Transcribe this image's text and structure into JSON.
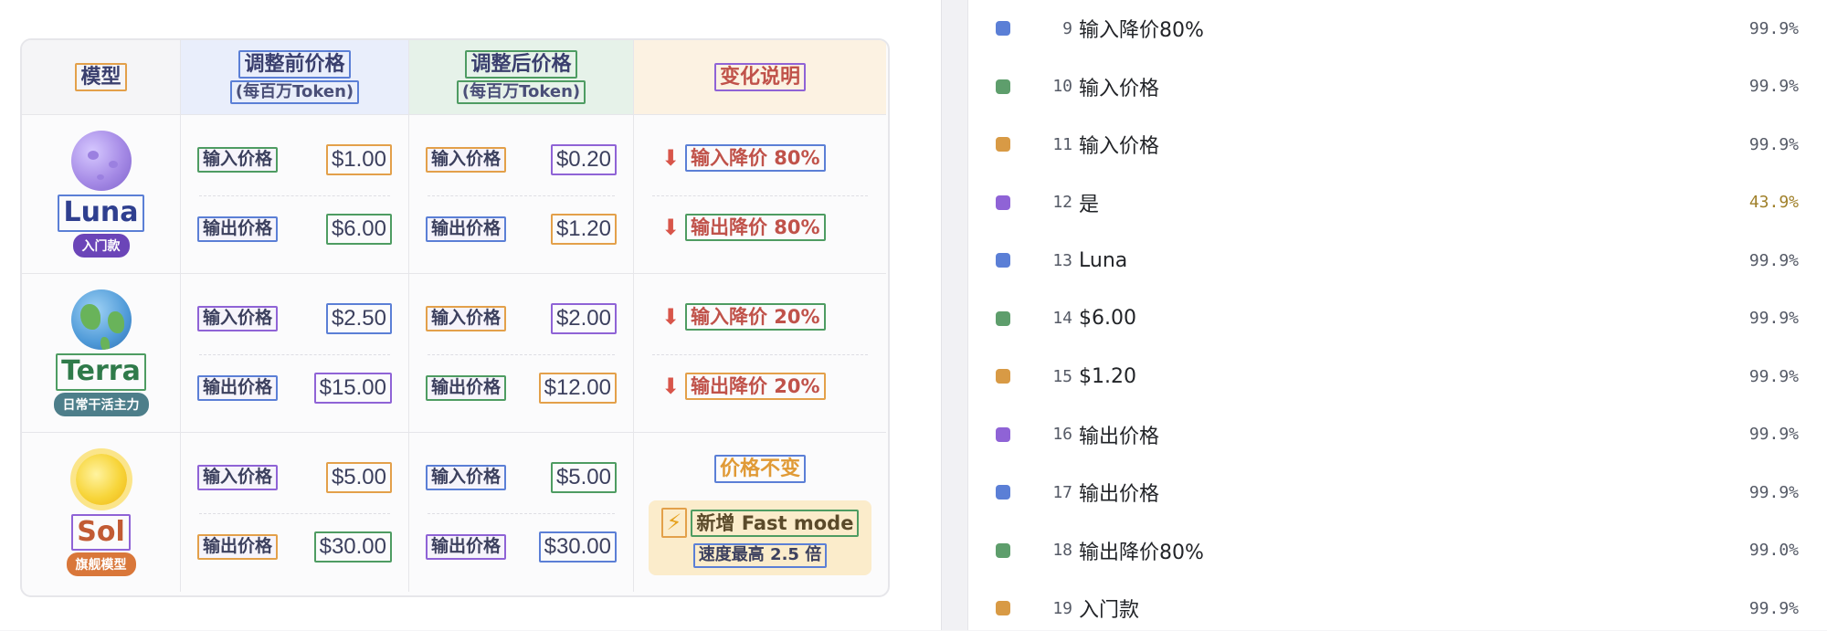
{
  "table": {
    "headers": {
      "model": "模型",
      "before_title": "调整前价格",
      "before_sub": "(每百万Token)",
      "after_title": "调整后价格",
      "after_sub": "(每百万Token)",
      "change": "变化说明"
    },
    "rows": [
      {
        "name": "Luna",
        "tag": "入门款",
        "before": {
          "in_label": "输入价格",
          "in_value": "$1.00",
          "out_label": "输出价格",
          "out_value": "$6.00"
        },
        "after": {
          "in_label": "输入价格",
          "in_value": "$0.20",
          "out_label": "输出价格",
          "out_value": "$1.20"
        },
        "change": {
          "in_text": "输入降价 80%",
          "out_text": "输出降价 80%"
        }
      },
      {
        "name": "Terra",
        "tag": "日常干活主力",
        "before": {
          "in_label": "输入价格",
          "in_value": "$2.50",
          "out_label": "输出价格",
          "out_value": "$15.00"
        },
        "after": {
          "in_label": "输入价格",
          "in_value": "$2.00",
          "out_label": "输出价格",
          "out_value": "$12.00"
        },
        "change": {
          "in_text": "输入降价 20%",
          "out_text": "输出降价 20%"
        }
      },
      {
        "name": "Sol",
        "tag": "旗舰模型",
        "before": {
          "in_label": "输入价格",
          "in_value": "$5.00",
          "out_label": "输出价格",
          "out_value": "$30.00"
        },
        "after": {
          "in_label": "输入价格",
          "in_value": "$5.00",
          "out_label": "输出价格",
          "out_value": "$30.00"
        },
        "change": {
          "unchanged": "价格不变",
          "fast_title": "新增 Fast mode",
          "fast_sub": "速度最高 2.5 倍"
        }
      }
    ]
  },
  "icons": {
    "down_arrow": "arrow-down-icon",
    "bolt": "lightning-bolt-icon"
  },
  "colors": {
    "blue": "#5b7fd6",
    "green": "#4e9c62",
    "orange": "#d89a45",
    "purple": "#8f63d6"
  },
  "detections": [
    {
      "index": "9",
      "label": "输入降价80%",
      "confidence": "99.9%",
      "color": "#5b7fd6"
    },
    {
      "index": "10",
      "label": "输入价格",
      "confidence": "99.9%",
      "color": "#5e9e6c"
    },
    {
      "index": "11",
      "label": "输入价格",
      "confidence": "99.9%",
      "color": "#d89a45"
    },
    {
      "index": "12",
      "label": "是",
      "confidence": "43.9%",
      "color": "#8f63d6"
    },
    {
      "index": "13",
      "label": "Luna",
      "confidence": "99.9%",
      "color": "#5b7fd6"
    },
    {
      "index": "14",
      "label": "$6.00",
      "confidence": "99.9%",
      "color": "#5e9e6c"
    },
    {
      "index": "15",
      "label": "$1.20",
      "confidence": "99.9%",
      "color": "#d89a45"
    },
    {
      "index": "16",
      "label": "输出价格",
      "confidence": "99.9%",
      "color": "#8f63d6"
    },
    {
      "index": "17",
      "label": "输出价格",
      "confidence": "99.9%",
      "color": "#5b7fd6"
    },
    {
      "index": "18",
      "label": "输出降价80%",
      "confidence": "99.0%",
      "color": "#5e9e6c"
    },
    {
      "index": "19",
      "label": "入门款",
      "confidence": "99.9%",
      "color": "#d89a45"
    }
  ]
}
